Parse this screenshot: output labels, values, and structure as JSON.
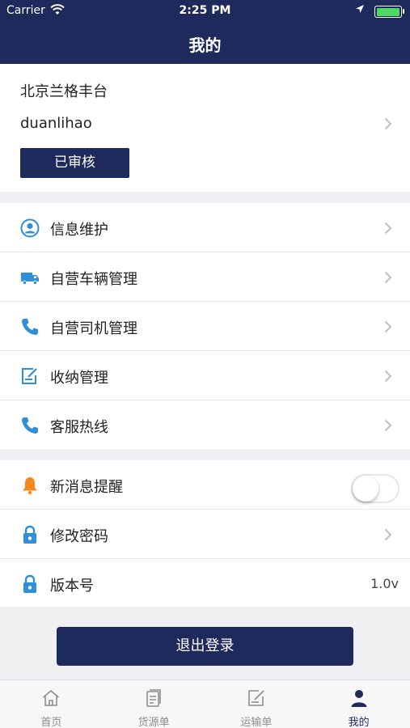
{
  "status_bar": {
    "carrier": "Carrier",
    "time": "2:25 PM"
  },
  "nav": {
    "title": "我的"
  },
  "profile": {
    "company": "北京兰格丰台",
    "username": "duanlihao",
    "status_badge": "已审核"
  },
  "menu": {
    "items": [
      {
        "label": "信息维护",
        "icon": "user-circle-icon"
      },
      {
        "label": "自营车辆管理",
        "icon": "truck-icon"
      },
      {
        "label": "自营司机管理",
        "icon": "phone-icon"
      },
      {
        "label": "收纳管理",
        "icon": "edit-note-icon"
      },
      {
        "label": "客服热线",
        "icon": "phone-icon"
      }
    ]
  },
  "settings": {
    "notifications": {
      "label": "新消息提醒",
      "icon": "bell-icon",
      "enabled": false
    },
    "change_password": {
      "label": "修改密码",
      "icon": "lock-icon"
    },
    "version": {
      "label": "版本号",
      "icon": "lock-icon",
      "value": "1.0v"
    }
  },
  "logout_label": "退出登录",
  "tabs": [
    {
      "label": "首页",
      "icon": "home-icon",
      "active": false
    },
    {
      "label": "货源单",
      "icon": "document-icon",
      "active": false
    },
    {
      "label": "运输单",
      "icon": "edit-document-icon",
      "active": false
    },
    {
      "label": "我的",
      "icon": "person-icon",
      "active": true
    }
  ],
  "colors": {
    "primary": "#1f2a5c",
    "icon_blue": "#2f8fd8",
    "bell_orange": "#f5871f",
    "battery_green": "#4cd964"
  }
}
